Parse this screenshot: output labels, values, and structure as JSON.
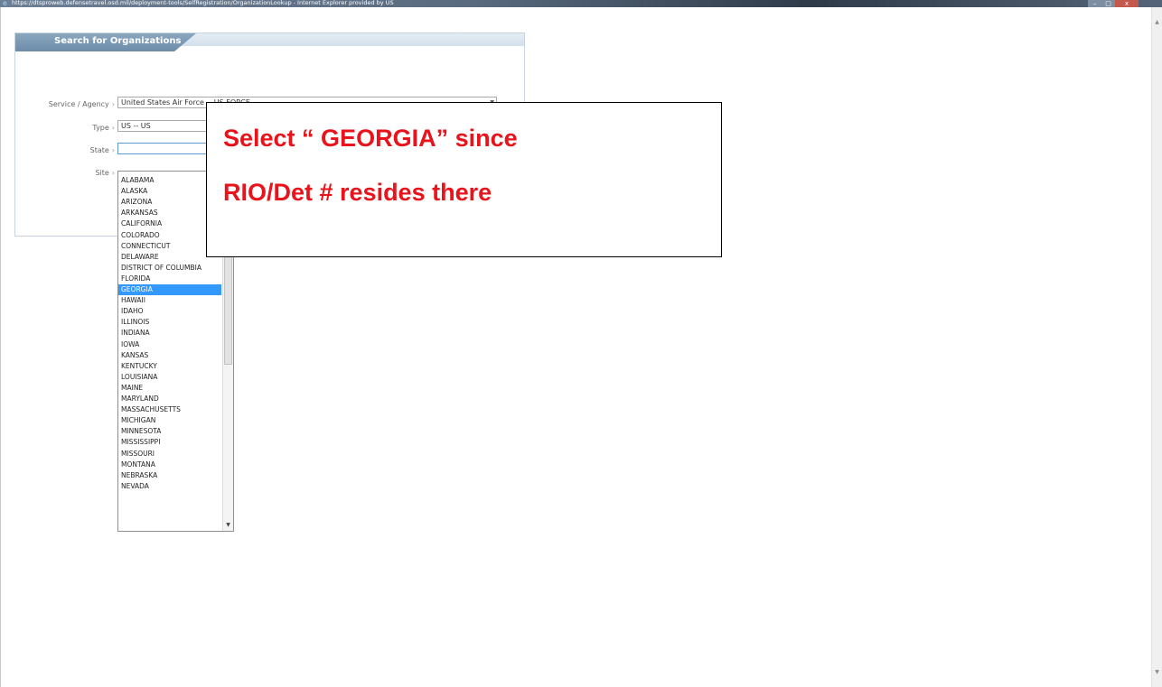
{
  "window": {
    "title": "https://dtsproweb.defensetravel.osd.mil/deployment-tools/SelfRegistration/OrganizationLookup - Internet Explorer provided by US"
  },
  "panel": {
    "title": "Search for Organizations"
  },
  "form": {
    "service_agency_label": "Service / Agency",
    "service_agency_value": "United States Air Force -- US FORCE",
    "type_label": "Type",
    "type_value": "US -- US",
    "state_label": "State",
    "state_value": "",
    "site_label": "Site"
  },
  "state_options": [
    "ALABAMA",
    "ALASKA",
    "ARIZONA",
    "ARKANSAS",
    "CALIFORNIA",
    "COLORADO",
    "CONNECTICUT",
    "DELAWARE",
    "DISTRICT OF COLUMBIA",
    "FLORIDA",
    "GEORGIA",
    "HAWAII",
    "IDAHO",
    "ILLINOIS",
    "INDIANA",
    "IOWA",
    "KANSAS",
    "KENTUCKY",
    "LOUISIANA",
    "MAINE",
    "MARYLAND",
    "MASSACHUSETTS",
    "MICHIGAN",
    "MINNESOTA",
    "MISSISSIPPI",
    "MISSOURI",
    "MONTANA",
    "NEBRASKA",
    "NEVADA"
  ],
  "selected_state": "GEORGIA",
  "callout": {
    "line1": "Select “ GEORGIA” since",
    "line2": "RIO/Det # resides there",
    "text_color": "#e8131b"
  },
  "colors": {
    "selection": "#3399ff",
    "panel_tab": "#7a98b3"
  }
}
